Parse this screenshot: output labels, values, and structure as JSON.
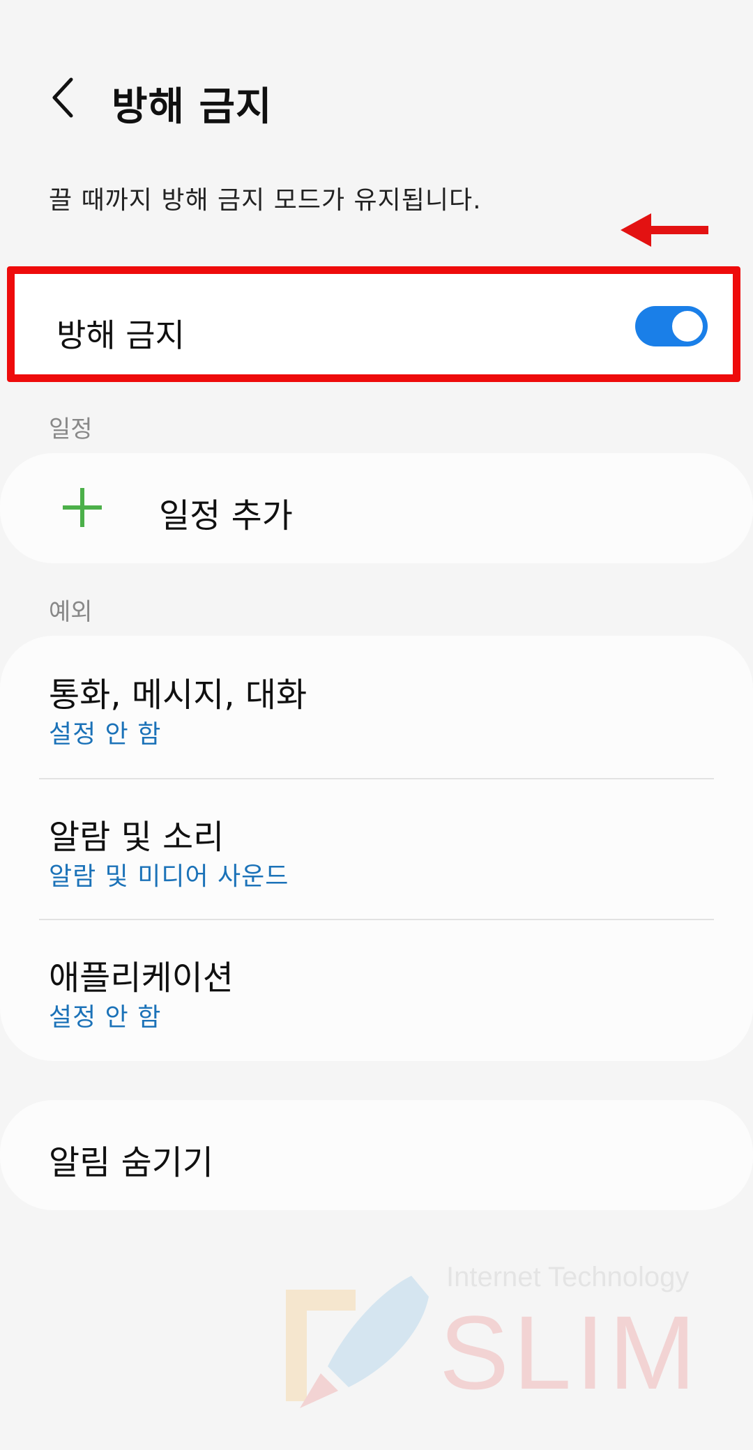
{
  "header": {
    "back_icon": "chevron-left-icon",
    "title": "방해 금지"
  },
  "description": "끌 때까지 방해 금지 모드가 유지됩니다.",
  "dnd": {
    "label": "방해 금지",
    "enabled": true,
    "accent_color": "#1a7fe8",
    "highlight_color": "#ee0b0b"
  },
  "schedule": {
    "section_label": "일정",
    "add_icon": "plus-icon",
    "add_label": "일정 추가"
  },
  "exceptions": {
    "section_label": "예외",
    "items": [
      {
        "title": "통화, 메시지, 대화",
        "subtitle": "설정 안 함"
      },
      {
        "title": "알람 및 소리",
        "subtitle": "알람 및 미디어 사운드"
      },
      {
        "title": "애플리케이션",
        "subtitle": "설정 안 함"
      }
    ]
  },
  "hide_notifications": {
    "label": "알림 숨기기"
  },
  "watermark": {
    "subtitle": "Internet Technology",
    "brand": "SLIM"
  }
}
